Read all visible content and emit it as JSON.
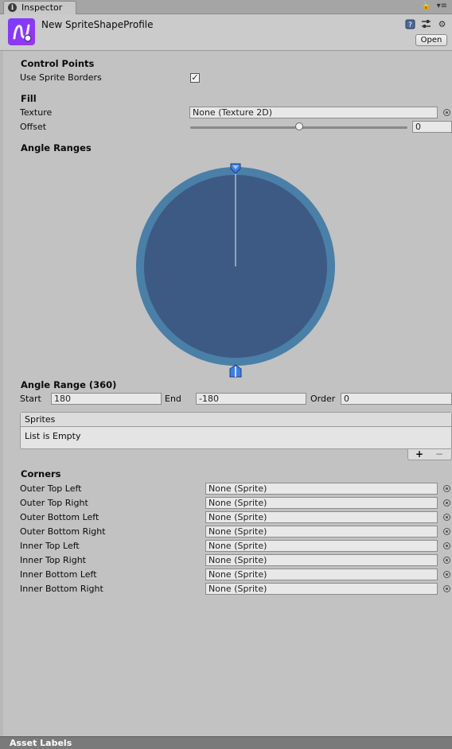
{
  "tab": {
    "label": "Inspector",
    "tools": [
      "🔒",
      "▾≡"
    ]
  },
  "header": {
    "asset_name": "New SpriteShapeProfile",
    "open_label": "Open"
  },
  "control_points": {
    "title": "Control Points",
    "use_sprite_borders_label": "Use Sprite Borders",
    "use_sprite_borders_checked": "✓"
  },
  "fill": {
    "title": "Fill",
    "texture_label": "Texture",
    "texture_value": "None (Texture 2D)",
    "offset_label": "Offset",
    "offset_value": "0",
    "offset_slider": 0.5
  },
  "angle_ranges": {
    "title": "Angle Ranges",
    "ring_color": "#4a7fa8",
    "disc_color": "#3c5a84"
  },
  "angle_range": {
    "title": "Angle Range (360)",
    "start_label": "Start",
    "start_value": "180",
    "end_label": "End",
    "end_value": "-180",
    "order_label": "Order",
    "order_value": "0"
  },
  "sprites": {
    "header": "Sprites",
    "empty_text": "List is Empty",
    "add": "+",
    "remove": "−"
  },
  "corners": {
    "title": "Corners",
    "items": [
      {
        "label": "Outer Top Left",
        "value": "None (Sprite)"
      },
      {
        "label": "Outer Top Right",
        "value": "None (Sprite)"
      },
      {
        "label": "Outer Bottom Left",
        "value": "None (Sprite)"
      },
      {
        "label": "Outer Bottom Right",
        "value": "None (Sprite)"
      },
      {
        "label": "Inner Top Left",
        "value": "None (Sprite)"
      },
      {
        "label": "Inner Top Right",
        "value": "None (Sprite)"
      },
      {
        "label": "Inner Bottom Left",
        "value": "None (Sprite)"
      },
      {
        "label": "Inner Bottom Right",
        "value": "None (Sprite)"
      }
    ]
  },
  "footer": {
    "asset_labels": "Asset Labels"
  }
}
